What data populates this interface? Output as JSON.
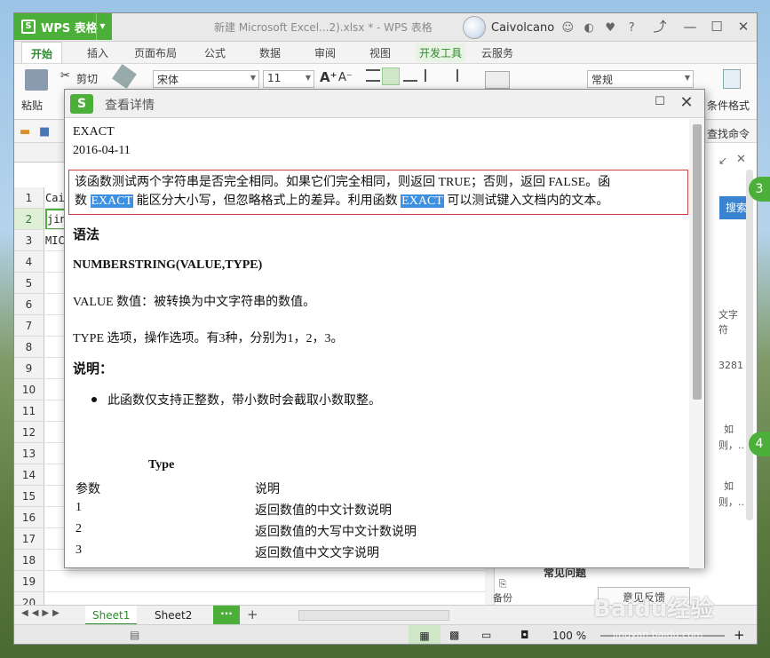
{
  "app": {
    "name": "WPS 表格",
    "doc_title": "新建 Microsoft Excel...2).xlsx * - WPS 表格",
    "user": "Caivolcano"
  },
  "ribbon_tabs": [
    "开始",
    "插入",
    "页面布局",
    "公式",
    "数据",
    "审阅",
    "视图",
    "开发工具",
    "云服务"
  ],
  "ribbon": {
    "paste": "粘贴",
    "cut": "剪切",
    "font": "宋体",
    "font_size": "11",
    "grow_font": "A⁺",
    "shrink_font": "A⁻",
    "number_format": "常规",
    "cond_format": "条件格式",
    "find_cmd": "查找命令"
  },
  "grid": {
    "rows": [
      "1",
      "2",
      "3",
      "4",
      "5",
      "6",
      "7",
      "8",
      "9",
      "10",
      "11",
      "12",
      "13",
      "14",
      "15",
      "16",
      "17",
      "18",
      "19",
      "20"
    ],
    "cells": [
      "Cai",
      "jin",
      "MIC"
    ]
  },
  "sheets": [
    "Sheet1",
    "Sheet2"
  ],
  "status": {
    "zoom": "100 %"
  },
  "taskpane": {
    "search": "搜索",
    "backup": "备份",
    "feedback": "意见反馈",
    "frag1": "文字",
    "frag2": "符",
    "frag3": "3281",
    "frag4": "如",
    "frag5": "则，..",
    "frag6": "如",
    "frag7": "则，..",
    "frag8": "常见问题"
  },
  "badges": [
    "3",
    "4"
  ],
  "watermark": {
    "text": "Baidu经验",
    "url": "jingyan.baidu.com"
  },
  "dialog": {
    "title": "查看详情",
    "func_name": "EXACT",
    "date": "2016-04-11",
    "desc_1": "该函数测试两个字符串是否完全相同。如果它们完全相同，则返回 TRUE；否则，返回 FALSE。函",
    "desc_2a": "数",
    "desc_hl1": "EXACT",
    "desc_2b": "能区分大小写，但忽略格式上的差异。利用函数",
    "desc_hl2": "EXACT",
    "desc_2c": "可以测试键入文档内的文本。",
    "syntax_heading": "语法",
    "syntax": "NUMBERSTRING(VALUE,TYPE)",
    "param_value": "VALUE 数值：被转换为中文字符串的数值。",
    "param_type": "TYPE 选项，操作选项。有3种，分别为1，2，3。",
    "notes_heading": "说明：",
    "note_1": "此函数仅支持正整数，带小数时会截取小数取整。",
    "table": {
      "caption": "Type",
      "headers": [
        "参数",
        "说明"
      ],
      "rows": [
        [
          "1",
          "返回数值的中文计数说明"
        ],
        [
          "2",
          "返回数值的大写中文计数说明"
        ],
        [
          "3",
          "返回数值中文文字说明"
        ]
      ]
    }
  }
}
